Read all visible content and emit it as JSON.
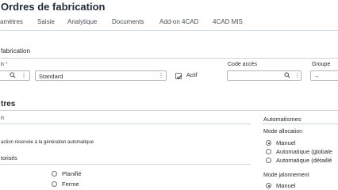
{
  "page": {
    "title": "Ordres de fabrication"
  },
  "tabs": [
    "amètres",
    "Saisie",
    "Analytique",
    "Documents",
    "Add-on 4CAD",
    "4CAD MIS"
  ],
  "header_section": {
    "label": "fabrication",
    "field1": {
      "label": "n",
      "required_mark": "*"
    },
    "standard_value": "Standard",
    "actif_label": "Actif",
    "code_acces_label": "Code accès",
    "groupe_label": "Groupe",
    "groupe_arrow": "→"
  },
  "parametres": {
    "heading": "tres",
    "sub": "n",
    "reserved_text": "action réservée à la génération automatique",
    "autorises_label": "torisés",
    "options": [
      "Planifié",
      "Ferme"
    ]
  },
  "automatismes": {
    "heading": "Automatismes",
    "mode_allocation_label": "Mode allocation",
    "allocation_options": [
      "Manuel",
      "Automatique (globale",
      "Automatique (détaillé"
    ],
    "allocation_selected": 0,
    "mode_jalonnement_label": "Mode jalonnement",
    "jalonnement_options": [
      "Manuel"
    ],
    "jalonnement_selected": 0
  }
}
